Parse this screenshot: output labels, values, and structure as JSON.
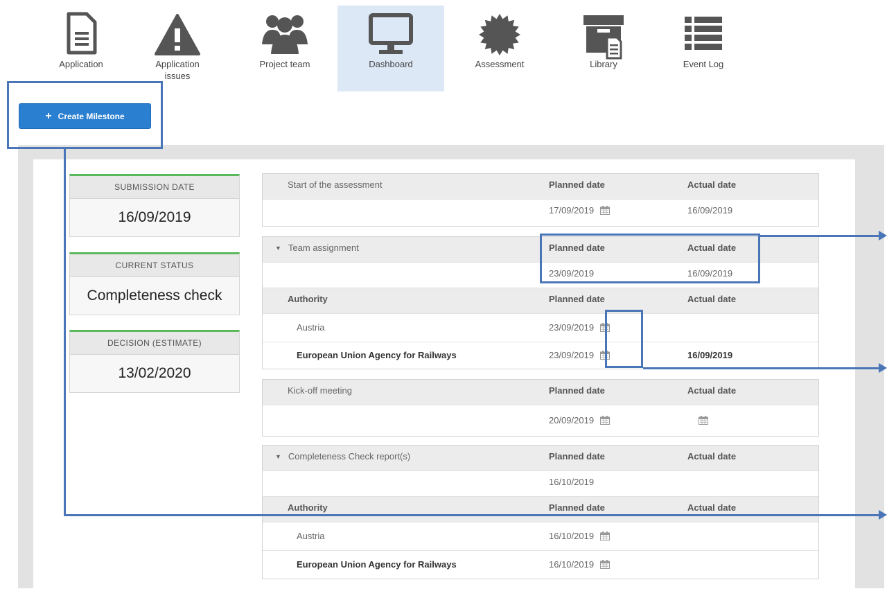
{
  "nav": [
    {
      "key": "application",
      "label": "Application",
      "icon": "document-icon"
    },
    {
      "key": "issues",
      "label": "Application issues",
      "icon": "warning-icon"
    },
    {
      "key": "team",
      "label": "Project team",
      "icon": "users-icon"
    },
    {
      "key": "dashboard",
      "label": "Dashboard",
      "icon": "monitor-icon"
    },
    {
      "key": "assessment",
      "label": "Assessment",
      "icon": "badge-icon"
    },
    {
      "key": "library",
      "label": "Library",
      "icon": "archive-icon"
    },
    {
      "key": "eventlog",
      "label": "Event Log",
      "icon": "list-icon"
    }
  ],
  "create_button": {
    "icon": "plus-icon",
    "label": "Create Milestone"
  },
  "cards": [
    {
      "title": "SUBMISSION DATE",
      "value": "16/09/2019"
    },
    {
      "title": "CURRENT STATUS",
      "value": "Completeness check"
    },
    {
      "title": "DECISION (ESTIMATE)",
      "value": "13/02/2020"
    }
  ],
  "headers": {
    "planned": "Planned date",
    "actual": "Actual date",
    "authority": "Authority"
  },
  "milestones": {
    "start": {
      "name": "Start of the assessment",
      "planned": "17/09/2019",
      "actual": "16/09/2019"
    },
    "team": {
      "name": "Team assignment",
      "planned": "23/09/2019",
      "actual": "16/09/2019",
      "authorities": [
        {
          "name": "Austria",
          "planned": "23/09/2019",
          "actual": ""
        },
        {
          "name": "European Union Agency for Railways",
          "planned": "23/09/2019",
          "actual": "16/09/2019"
        }
      ]
    },
    "kickoff": {
      "name": "Kick-off meeting",
      "planned": "20/09/2019",
      "actual": ""
    },
    "completeness": {
      "name": "Completeness Check report(s)",
      "planned": "16/10/2019",
      "actual": "",
      "authorities": [
        {
          "name": "Austria",
          "planned": "16/10/2019",
          "actual": ""
        },
        {
          "name": "European Union Agency for Railways",
          "planned": "16/10/2019",
          "actual": ""
        }
      ]
    }
  },
  "colors": {
    "primary": "#2b7fd0",
    "annotation": "#4a76b8",
    "card_accent": "#5cb85c",
    "nav_active": "#dde8f6"
  }
}
